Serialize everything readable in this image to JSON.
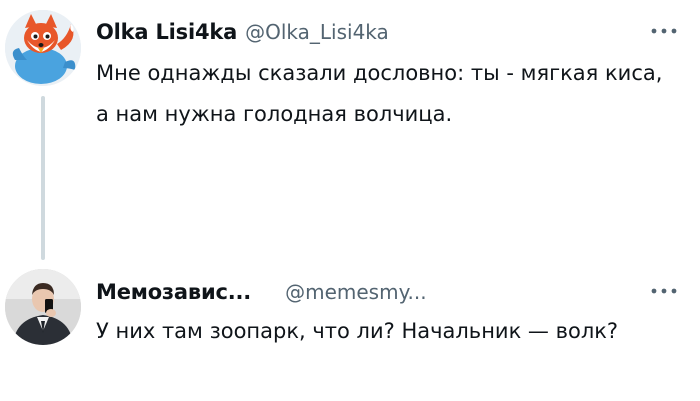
{
  "tweets": [
    {
      "display_name": "Olka Lisi4ka",
      "handle": "@Olka_Lisi4ka",
      "text": "Мне однажды сказали дословно: ты - мягкая киса, а нам нужна голодная волчица.",
      "avatar_icon": "fox-avatar-icon",
      "more_icon": "more-options-icon"
    },
    {
      "display_name": "Мемозавис...",
      "handle": "@memesmy...",
      "text": "У них там зоопарк, что ли? Начальник — волк?",
      "avatar_icon": "person-photo-avatar",
      "more_icon": "more-options-icon"
    }
  ],
  "colors": {
    "text": "#0f1419",
    "secondary": "#536471",
    "thread_line": "#cfd9de"
  }
}
